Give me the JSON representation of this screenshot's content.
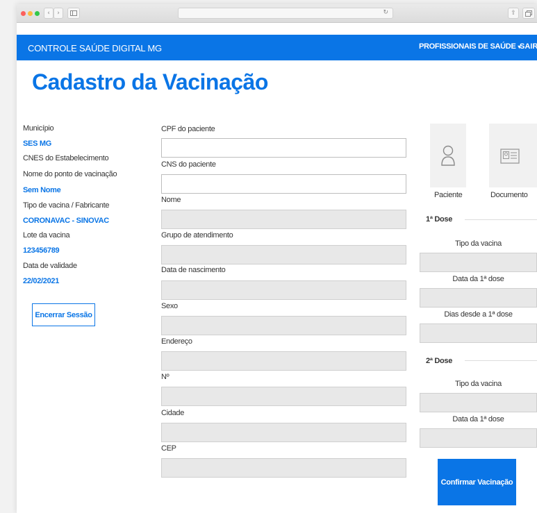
{
  "browser": {
    "back_glyph": "‹",
    "forward_glyph": "›",
    "reload_glyph": "↻",
    "share_glyph": "⇧"
  },
  "navbar": {
    "brand": "CONTROLE SAÚDE DIGITAL MG",
    "professionals_menu": "PROFISSIONAIS DE SAÚDE",
    "caret": "▾",
    "logout": "SAIR"
  },
  "page": {
    "title": "Cadastro da Vacinação"
  },
  "session_info": {
    "municipio_label": "Município",
    "municipio_value": "SES MG",
    "cnes_label": "CNES do Estabelecimento",
    "ponto_label": "Nome do ponto de vacinação",
    "ponto_value": "Sem Nome",
    "tipo_label": "Tipo de vacina / Fabricante",
    "tipo_value": "CORONAVAC - SINOVAC",
    "lote_label": "Lote da vacina",
    "lote_value": "123456789",
    "validade_label": "Data de validade",
    "validade_value": "22/02/2021",
    "end_session_button": "Encerrar Sessão"
  },
  "form": {
    "cpf_label": "CPF do paciente",
    "cns_label": "CNS do paciente",
    "nome_label": "Nome",
    "grupo_label": "Grupo de atendimento",
    "nascimento_label": "Data de nascimento",
    "sexo_label": "Sexo",
    "endereco_label": "Endereço",
    "numero_label": "Nº",
    "cidade_label": "Cidade",
    "cep_label": "CEP"
  },
  "right_panel": {
    "patient_card_label": "Paciente",
    "document_card_label": "Documento",
    "dose1": {
      "title": "1ª Dose",
      "tipo_label": "Tipo da vacina",
      "data_label": "Data da 1ª dose",
      "dias_label": "Dias desde a 1ª dose"
    },
    "dose2": {
      "title": "2ª Dose",
      "tipo_label": "Tipo da vacina",
      "data_label": "Data da 1ª dose"
    },
    "confirm_button": "Confirmar Vacinação"
  }
}
